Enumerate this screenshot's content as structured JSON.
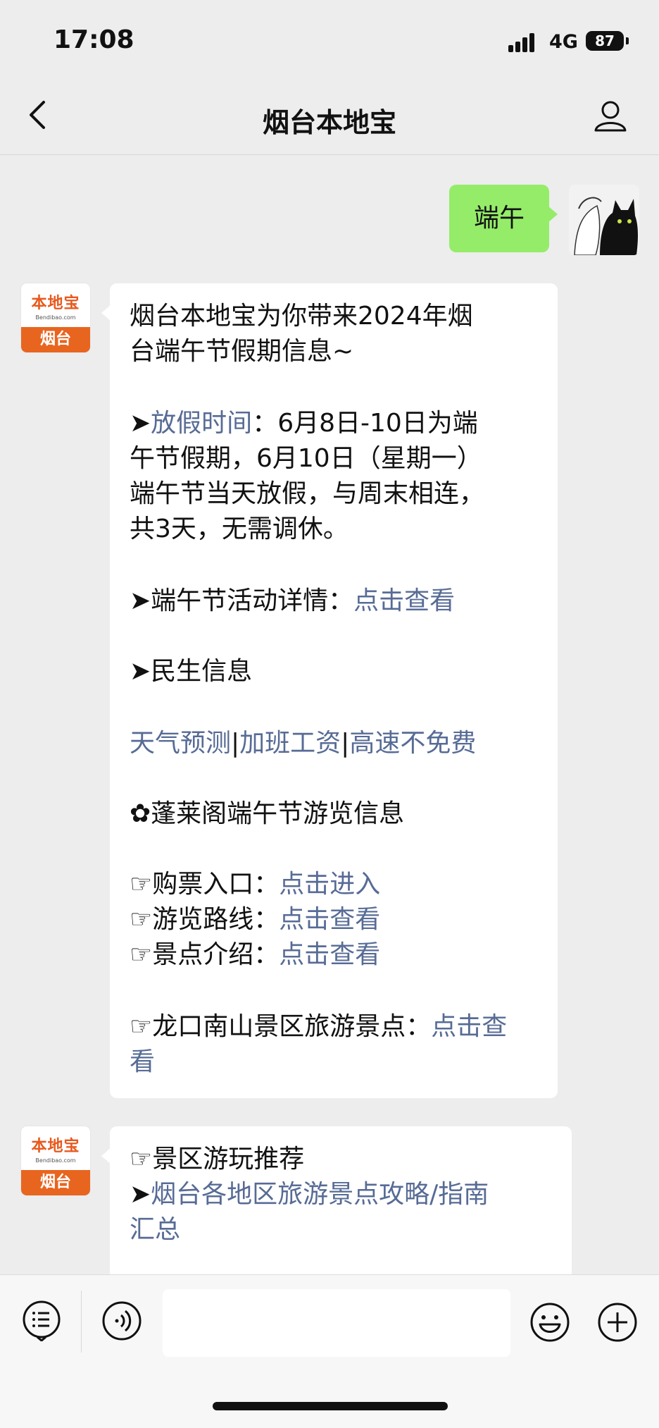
{
  "status_bar": {
    "time": "17:08",
    "network": "4G",
    "battery": "87"
  },
  "nav": {
    "title": "烟台本地宝"
  },
  "user_message": {
    "text": "端午"
  },
  "bot": {
    "avatar_brand": "本地宝",
    "avatar_site": "Bendibao.com",
    "avatar_city": "烟台"
  },
  "message1": {
    "intro_1": "烟台本地宝为你带来2024年烟",
    "intro_2": "台端午节假期信息~",
    "holiday_bullet": "➤",
    "holiday_label": "放假时间",
    "holiday_text_1": "：6月8日-10日为端",
    "holiday_text_2": "午节假期，6月10日（星期一）",
    "holiday_text_3": "端午节当天放假，与周末相连，",
    "holiday_text_4": "共3天，无需调休。",
    "activity_prefix": "➤端午节活动详情：",
    "activity_link": "点击查看",
    "livelihood_title": "➤民生信息",
    "link_weather": "天气预测",
    "link_overtime": "加班工资",
    "link_highway": "高速不免费",
    "divider": "|",
    "penglai_title": "✿蓬莱阁端午节游览信息",
    "ticket_prefix": "☞购票入口：",
    "ticket_link": "点击进入",
    "route_prefix": "☞游览路线：",
    "route_link": "点击查看",
    "spot_prefix": "☞景点介绍：",
    "spot_link": "点击查看",
    "longkou_prefix": "☞龙口南山景区旅游景点：",
    "longkou_link_1": "点击查",
    "longkou_link_2": "看"
  },
  "message2": {
    "recommend": "☞景区游玩推荐",
    "guide_bullet": "➤",
    "guide_link_1": "烟台各地区旅游景点攻略/指南",
    "guide_link_2": "汇总"
  }
}
